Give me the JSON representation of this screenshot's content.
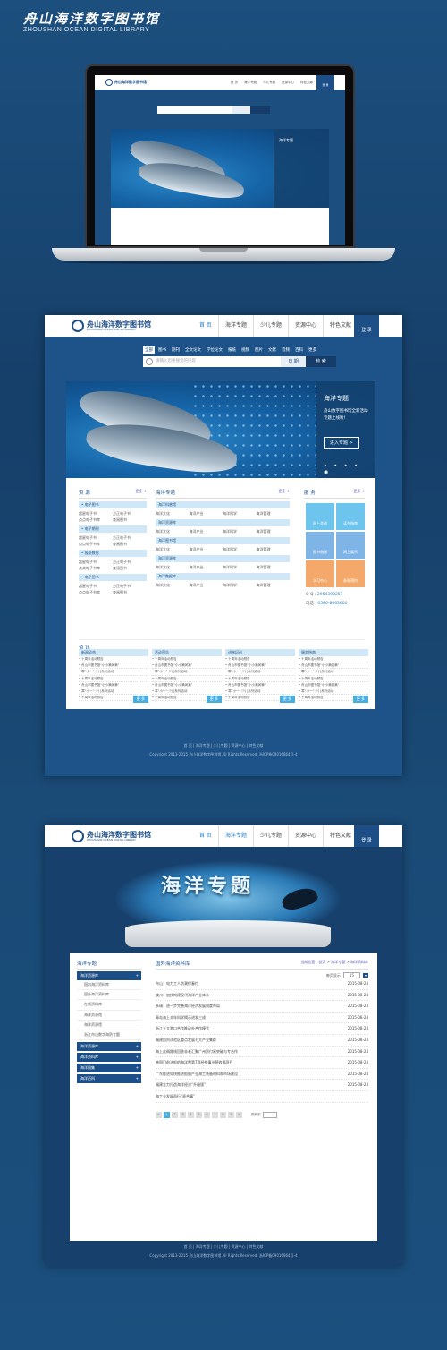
{
  "brand": {
    "title_cn": "舟山海洋数字图书馆",
    "title_en": "ZHOUSHAN OCEAN  DIGITAL LIBRARY"
  },
  "nav": {
    "items": [
      "首 页",
      "海洋专题",
      "少儿专题",
      "资源中心",
      "特色文献"
    ],
    "login": "登 录"
  },
  "categories": [
    "全部",
    "图书",
    "期刊",
    "全文论文",
    "学位论文",
    "报纸",
    "视频",
    "图片",
    "文献",
    "音频",
    "百科",
    "更多"
  ],
  "search": {
    "placeholder": "请输入您要搜索的内容",
    "select": "日 期",
    "button": "检 索"
  },
  "banner": {
    "title": "海洋专题",
    "text": "舟山数字图书馆全新活动专题上线啦！",
    "button": "进入专题 >"
  },
  "resources": {
    "title": "资 源",
    "more": "更多 +",
    "groups": [
      {
        "label": "• 电子图书",
        "items": [
          "超星电子书",
          "方正电子书",
          "点点电子书库",
          "查阅图书"
        ]
      },
      {
        "label": "• 电子期刊",
        "items": [
          "超星电子书",
          "方正电子书",
          "点点电子书库",
          "查阅图书"
        ]
      },
      {
        "label": "• 报纸数据",
        "items": [
          "超星电子书",
          "方正电子书",
          "点点电子书库",
          "查阅图书"
        ]
      },
      {
        "label": "• 电子图书",
        "items": [
          "超星电子书",
          "方正电子书",
          "点点电子书库",
          "查阅图书"
        ]
      }
    ]
  },
  "ocean": {
    "title": "海洋专题",
    "more": "更多 +",
    "groups": [
      {
        "label": "海洋科普馆",
        "items": [
          "海洋文化",
          "海洋产业",
          "海洋科学",
          "海洋管理"
        ]
      },
      {
        "label": "海洋资源库",
        "items": [
          "海洋文化",
          "海洋产业",
          "海洋科学",
          "海洋管理"
        ]
      },
      {
        "label": "海洋图书馆",
        "items": [
          "海洋文化",
          "海洋产业",
          "海洋科学",
          "海洋管理"
        ]
      },
      {
        "label": "海洋资源库",
        "items": [
          "海洋文化",
          "海洋产业",
          "海洋科学",
          "海洋管理"
        ]
      },
      {
        "label": "海洋数据库",
        "items": [
          "海洋文化",
          "海洋产业",
          "海洋科学",
          "海洋管理"
        ]
      }
    ]
  },
  "service": {
    "title": "服 务",
    "more": "更多 +",
    "tiles": [
      "网上咨询",
      "读书指南",
      "图书借阅",
      "网上展示",
      "学习中心",
      "参观预约"
    ],
    "qq_label": "Q Q :",
    "qq": "2954390251",
    "tel_label": "电话 :",
    "tel": "0580-8063600"
  },
  "news": {
    "title": "资 讯",
    "more": "更 多",
    "cols": [
      {
        "head": "新闻动态",
        "items": [
          "• 十周年活动预告",
          "• 舟山市图书馆“小小满润满”",
          "• 寒“小一”·少儿系列活动",
          "• 十周年活动预告",
          "• 舟山市图书馆“小小满润满”",
          "• 寒“小一”·少儿系列活动",
          "• 十周年活动预告"
        ]
      },
      {
        "head": "活动预告",
        "items": [
          "• 十周年活动预告",
          "• 舟山市图书馆“小小满润满”",
          "• 寒“小一”·少儿系列活动",
          "• 十周年活动预告",
          "• 舟山市图书馆“小小满润满”",
          "• 寒“小一”·少儿系列活动",
          "• 十周年活动预告"
        ]
      },
      {
        "head": "讲座培训",
        "items": [
          "• 十周年活动预告",
          "• 舟山市图书馆“小小满润满”",
          "• 寒“小一”·少儿系列活动",
          "• 十周年活动预告",
          "• 舟山市图书馆“小小满润满”",
          "• 寒“小一”·少儿系列活动",
          "• 十周年活动预告"
        ]
      },
      {
        "head": "服务指南",
        "items": [
          "• 十周年活动预告",
          "• 舟山市图书馆“小小满润满”",
          "• 寒“小一”·少儿系列活动",
          "• 十周年活动预告",
          "• 舟山市图书馆“小小满润满”",
          "• 寒“小一”·少儿系列活动",
          "• 十周年活动预告"
        ]
      }
    ]
  },
  "footer": {
    "links": "首 页  |  海洋专题  |  少儿专题  |  资源中心  |  特色文献",
    "copyright": "Copyright 2013-2015 舟山海洋数字图书馆 All Rights Reserved. 浙ICP备09016864号-4"
  },
  "topic": {
    "hero": "海洋专题",
    "side_title": "海洋专题",
    "tree": [
      {
        "label": "海洋资源库",
        "type": "t"
      },
      {
        "label": "国内海洋资料库",
        "type": "i"
      },
      {
        "label": "国外海洋资料库",
        "type": "i"
      },
      {
        "label": "在线资料库",
        "type": "i"
      },
      {
        "label": "海洋资源馆",
        "type": "i"
      },
      {
        "label": "海洋资源馆",
        "type": "i"
      },
      {
        "label": "浙江舟山数字海防专题",
        "type": "i"
      },
      {
        "label": "海洋资源库",
        "type": "t"
      },
      {
        "label": "海洋资料库",
        "type": "t"
      },
      {
        "label": "海洋图集",
        "type": "t"
      },
      {
        "label": "海洋百科",
        "type": "t"
      }
    ],
    "list_title": "国外海洋资料库",
    "crumb": "当前位置：首页 > 海洋专题 > 海洋资料库",
    "per_page_label": "每页显示",
    "per_page": "15",
    "rows": [
      {
        "t": "舟山：电力工人防潮保春忙",
        "d": "2015-08-24"
      },
      {
        "t": "澳州：加快构建现代海洋产业体系",
        "d": "2015-08-24"
      },
      {
        "t": "多瑞：进一步完善海洋经济发展制度布局",
        "d": "2015-08-24"
      },
      {
        "t": "青岛海上丰年科学揭示进发三成",
        "d": "2015-08-24"
      },
      {
        "t": "浙江五大港口合作推动外合作模式",
        "d": "2015-08-24"
      },
      {
        "t": "福建自贸试验区重点发展七大产业集群",
        "d": "2015-08-24"
      },
      {
        "t": "海上丝绸路线回答非老汇聚广州贸付易突破与专合作",
        "d": "2015-08-24"
      },
      {
        "t": "韩国门前油船的海洋费第7项经依事业营收调项目",
        "d": "2015-08-24"
      },
      {
        "t": "广东推进如快推进船舶产业海工装备材料和市场建设",
        "d": "2015-08-24"
      },
      {
        "t": "福建全力打造海洋经济“升级版”",
        "d": "2015-08-24"
      },
      {
        "t": "海工业发展再行“驱合事”",
        "d": ""
      }
    ],
    "pages": [
      "<",
      "1",
      "2",
      "3",
      "4",
      "5",
      "6",
      "7",
      "8",
      "9",
      ">"
    ],
    "goto": "跳转到"
  }
}
